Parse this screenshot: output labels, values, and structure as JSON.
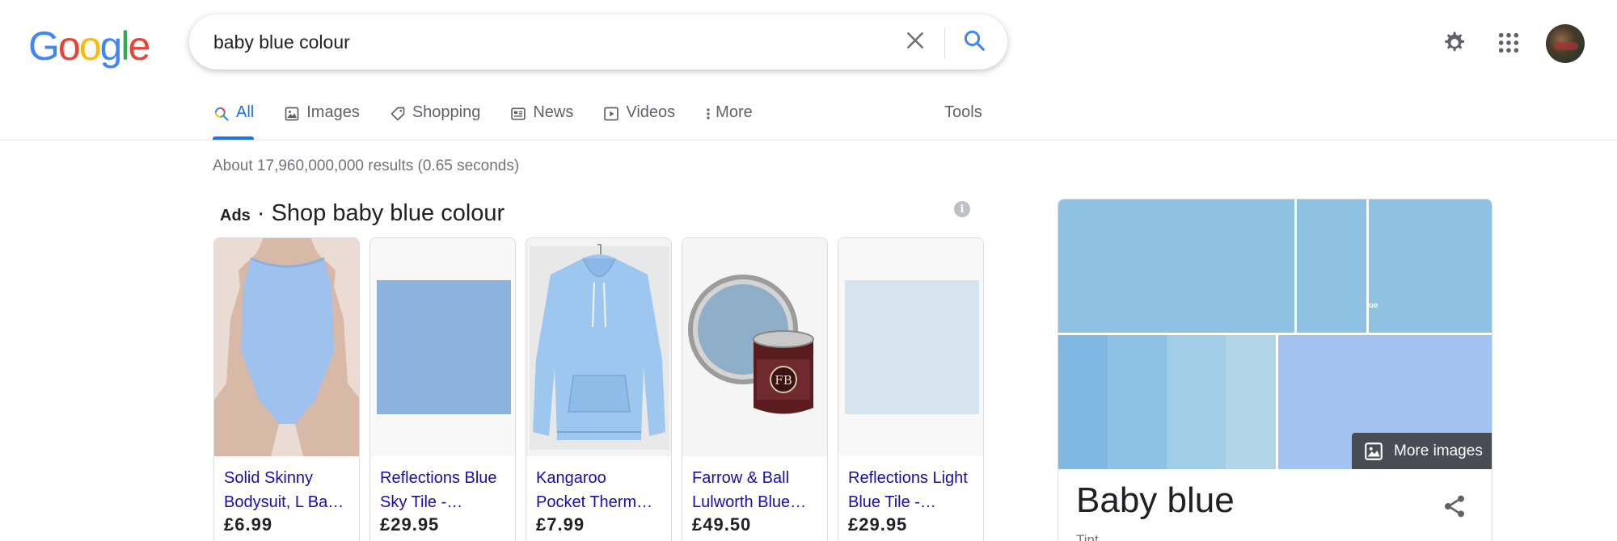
{
  "logo": {
    "letters": [
      "G",
      "o",
      "o",
      "g",
      "l",
      "e"
    ],
    "colors": [
      "#4285F4",
      "#EA4335",
      "#FBBC05",
      "#4285F4",
      "#34A853",
      "#EA4335"
    ]
  },
  "search": {
    "query": "baby blue colour"
  },
  "tabs": [
    {
      "label": "All",
      "icon": "search-icon",
      "active": true
    },
    {
      "label": "Images",
      "icon": "image-icon"
    },
    {
      "label": "Shopping",
      "icon": "tag-icon"
    },
    {
      "label": "News",
      "icon": "news-icon"
    },
    {
      "label": "Videos",
      "icon": "play-icon"
    },
    {
      "label": "More",
      "icon": "more-vert-icon"
    }
  ],
  "tools_label": "Tools",
  "result_stats": "About 17,960,000,000 results (0.65 seconds)",
  "ads": {
    "label": "Ads",
    "separator": " · ",
    "heading": "Shop baby blue colour",
    "products": [
      {
        "name_line1": "Solid Skinny",
        "name_line2": "Bodysuit, L Ba…",
        "price": "£6.99",
        "image": "bodysuit"
      },
      {
        "name_line1": "Reflections Blue",
        "name_line2": "Sky Tile -…",
        "price": "£29.95",
        "image": "tile",
        "swatch": "#8db3dc"
      },
      {
        "name_line1": "Kangaroo",
        "name_line2": "Pocket Therm…",
        "price": "£7.99",
        "image": "hoodie"
      },
      {
        "name_line1": "Farrow & Ball",
        "name_line2": "Lulworth Blue…",
        "price": "£49.50",
        "image": "paint"
      },
      {
        "name_line1": "Reflections Light",
        "name_line2": "Blue Tile -…",
        "price": "£29.95",
        "image": "tile",
        "swatch": "#d5e4ee"
      }
    ]
  },
  "knowledge_panel": {
    "title": "Baby blue",
    "subtitle": "Tint",
    "more_images_label": "More images",
    "tile_colors": [
      "#8fc1e3",
      "#8fc1e3",
      "#8fc1e3",
      "#7db7e2",
      "#8ec2e5",
      "#a1cde6",
      "#b2d6e8",
      "#a2c3f0"
    ],
    "tile_caption": "lue"
  }
}
